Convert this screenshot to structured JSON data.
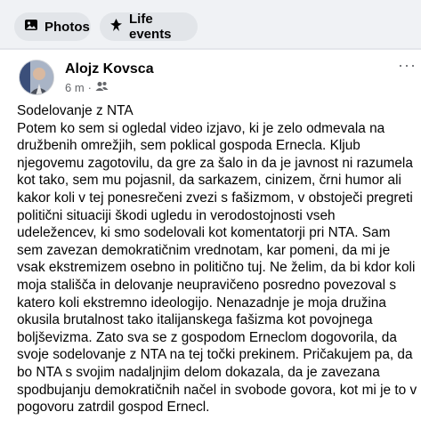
{
  "tabs": {
    "photos_label": "Photos",
    "life_events_label": "Life events"
  },
  "post": {
    "author": "Alojz Kovsca",
    "time": "6 m",
    "audience_icon": "friends-icon",
    "title_line": "Sodelovanje z NTA",
    "body": "Potem ko sem si ogledal video izjavo, ki je zelo odmevala na družbenih omrežjih, sem poklical gospoda Ernecla. Kljub njegovemu zagotovilu, da gre za šalo in da je javnost ni razumela kot tako, sem mu pojasnil, da sarkazem, cinizem, črni humor ali kakor koli v tej ponesrečeni zvezi s fašizmom, v obstoječi pregreti politični situaciji škodi ugledu in verodostojnosti vseh udeležencev, ki smo sodelovali kot komentatorji pri NTA. Sam sem zavezan demokratičnim vrednotam, kar pomeni, da mi je vsak ekstremizem osebno in politično tuj. Ne želim, da bi kdor koli moja stališča in delovanje neupravičeno posredno povezoval s katero koli ekstremno ideologijo. Nenazadnje je moja družina okusila brutalnost tako italijanskega fašizma kot povojnega boljševizma. Zato sva se z gospodom Erneclom dogovorila, da svoje sodelovanje z NTA na tej točki prekinem. Pričakujem pa, da bo NTA s svojim nadaljnjim delom dokazala, da je zavezana spodbujanju demokratičnih načel in svobode govora, kot mi je to v pogovoru zatrdil gospod Ernecl."
  },
  "colors": {
    "chip_bg": "#e2e5e9",
    "header_bg": "#f0f2f5",
    "meta_text": "#65676b"
  }
}
